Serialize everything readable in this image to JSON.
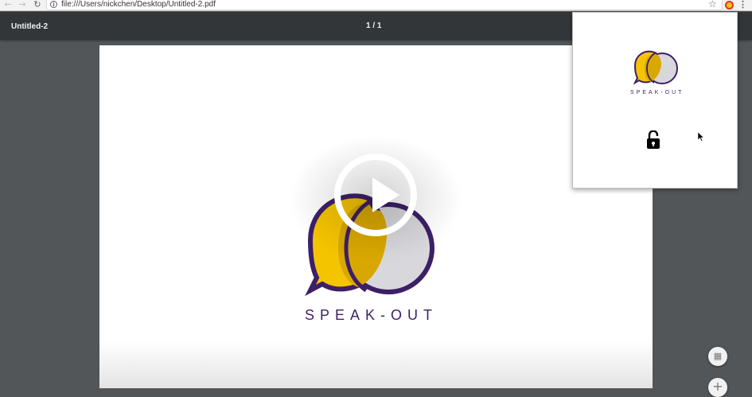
{
  "browser": {
    "url": "file:///Users/nickchen/Desktop/Untitled-2.pdf",
    "back_icon": "arrow-left-icon",
    "forward_icon": "arrow-right-icon",
    "reload_icon": "reload-icon",
    "info_icon": "info-icon",
    "bookmark_icon": "star-icon",
    "extension_icon": "speakout-extension-icon",
    "menu_icon": "kebab-menu-icon"
  },
  "pdf_viewer": {
    "document_title": "Untitled-2",
    "page_indicator": "1 / 1",
    "fit_icon": "fit-to-page-icon",
    "zoom_in_icon": "zoom-in-icon"
  },
  "document": {
    "brand_text": "SPEAK-OUT",
    "logo_icon": "speak-out-logo",
    "colors": {
      "yellow": "#f5c400",
      "gold": "#d9a800",
      "purple": "#3d1f67",
      "grey": "#d8d8dc"
    }
  },
  "video_overlay": {
    "play_icon": "play-icon"
  },
  "popup": {
    "brand_text": "SPEAK-OUT",
    "logo_icon": "speak-out-logo",
    "lock_icon": "lock-open-icon",
    "cursor_icon": "mouse-cursor-icon"
  }
}
